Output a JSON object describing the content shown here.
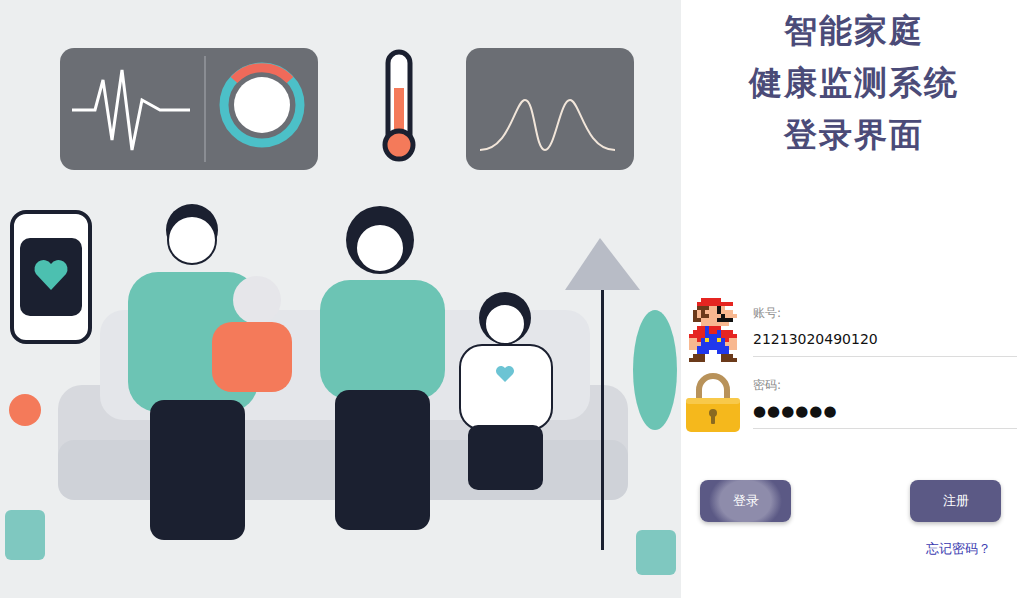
{
  "title_lines": [
    "智能家庭",
    "健康监测系统",
    "登录界面"
  ],
  "fields": [
    {
      "label": "账号:",
      "value": "21213020490120",
      "kind": "account"
    },
    {
      "label": "密码:",
      "value": "●●●●●●",
      "kind": "password"
    }
  ],
  "buttons": [
    {
      "label": "登录",
      "pressed": true
    },
    {
      "label": "注册",
      "pressed": false
    }
  ],
  "forgot_link": "忘记密码？"
}
